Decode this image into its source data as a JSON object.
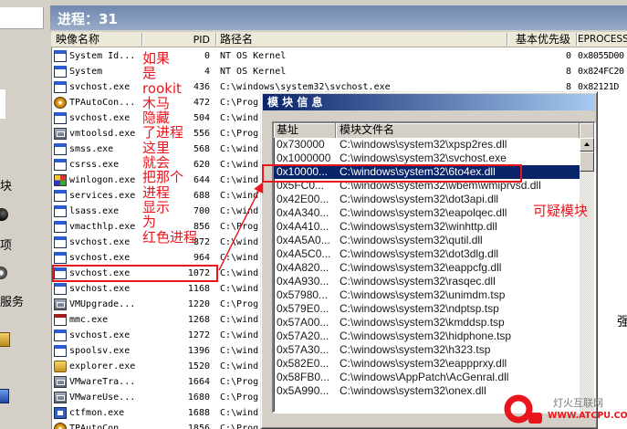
{
  "window": {
    "title": "进程：31"
  },
  "sidebar": {
    "labels": [
      "块",
      "项",
      "服务"
    ]
  },
  "process_list": {
    "columns": {
      "name": "映像名称",
      "pid": "PID",
      "path": "路径名",
      "priority": "基本优先级",
      "eprocess": "EPROCESS"
    },
    "rows": [
      {
        "icon": "app-window-icon",
        "name": "System Id...",
        "pid": "0",
        "path": "NT OS Kernel",
        "priority": "0",
        "eprocess": "0x8055D00"
      },
      {
        "icon": "app-window-icon",
        "name": "System",
        "pid": "4",
        "path": "NT OS Kernel",
        "priority": "8",
        "eprocess": "0x824FC20"
      },
      {
        "icon": "app-window-icon",
        "name": "svchost.exe",
        "pid": "436",
        "path": "C:\\windows\\system32\\svchost.exe",
        "priority": "8",
        "eprocess": "0x82121D"
      },
      {
        "icon": "gear-icon",
        "name": "TPAutoCon...",
        "pid": "472",
        "path": "C:\\Prog"
      },
      {
        "icon": "app-window-icon",
        "name": "svchost.exe",
        "pid": "504",
        "path": "C:\\wind"
      },
      {
        "icon": "vmware-icon",
        "name": "vmtoolsd.exe",
        "pid": "556",
        "path": "C:\\Prog"
      },
      {
        "icon": "app-window-icon",
        "name": "smss.exe",
        "pid": "568",
        "path": "C:\\wind"
      },
      {
        "icon": "app-window-icon",
        "name": "csrss.exe",
        "pid": "620",
        "path": "C:\\wind"
      },
      {
        "icon": "winlogon-icon",
        "name": "winlogon.exe",
        "pid": "644",
        "path": "C:\\wind"
      },
      {
        "icon": "app-window-icon",
        "name": "services.exe",
        "pid": "688",
        "path": "C:\\wind"
      },
      {
        "icon": "app-window-icon",
        "name": "lsass.exe",
        "pid": "700",
        "path": "C:\\wind"
      },
      {
        "icon": "app-window-icon",
        "name": "vmacthlp.exe",
        "pid": "856",
        "path": "C:\\Prog"
      },
      {
        "icon": "app-window-icon",
        "name": "svchost.exe",
        "pid": "872",
        "path": "C:\\wind"
      },
      {
        "icon": "app-window-icon",
        "name": "svchost.exe",
        "pid": "964",
        "path": "C:\\wind"
      },
      {
        "icon": "app-window-icon",
        "name": "svchost.exe",
        "pid": "1072",
        "path": "C:\\wind"
      },
      {
        "icon": "app-window-icon",
        "name": "svchost.exe",
        "pid": "1168",
        "path": "C:\\wind"
      },
      {
        "icon": "vmware-icon",
        "name": "VMUpgrade...",
        "pid": "1220",
        "path": "C:\\Prog"
      },
      {
        "icon": "mmc-icon",
        "name": "mmc.exe",
        "pid": "1268",
        "path": "C:\\wind"
      },
      {
        "icon": "app-window-icon",
        "name": "svchost.exe",
        "pid": "1272",
        "path": "C:\\wind"
      },
      {
        "icon": "app-window-icon",
        "name": "spoolsv.exe",
        "pid": "1396",
        "path": "C:\\wind"
      },
      {
        "icon": "explorer-icon",
        "name": "explorer.exe",
        "pid": "1520",
        "path": "C:\\wind"
      },
      {
        "icon": "vmware-icon",
        "name": "VMwareTra...",
        "pid": "1664",
        "path": "C:\\Prog"
      },
      {
        "icon": "vmware-icon",
        "name": "VMwareUse...",
        "pid": "1680",
        "path": "C:\\Prog"
      },
      {
        "icon": "ctfmon-icon",
        "name": "ctfmon.exe",
        "pid": "1688",
        "path": "C:\\wind"
      },
      {
        "icon": "gear-icon",
        "name": "TPAutoCon...",
        "pid": "1856",
        "path": "C:\\Prog"
      }
    ]
  },
  "module_dialog": {
    "title": "模 块 信 息",
    "columns": {
      "base": "基址",
      "file": "模块文件名"
    },
    "selected_index": 2,
    "rows": [
      {
        "base": "0x730000",
        "file": "C:\\windows\\system32\\xpsp2res.dll"
      },
      {
        "base": "0x1000000",
        "file": "C:\\windows\\system32\\svchost.exe"
      },
      {
        "base": "0x10000...",
        "file": "C:\\windows\\system32\\6to4ex.dll"
      },
      {
        "base": "0x5FC0...",
        "file": "C:\\windows\\system32\\wbem\\wmiprvsd.dll"
      },
      {
        "base": "0x42E00...",
        "file": "C:\\windows\\system32\\dot3api.dll"
      },
      {
        "base": "0x4A340...",
        "file": "C:\\windows\\system32\\eapolqec.dll"
      },
      {
        "base": "0x4A410...",
        "file": "C:\\windows\\system32\\winhttp.dll"
      },
      {
        "base": "0x4A5A0...",
        "file": "C:\\windows\\system32\\qutil.dll"
      },
      {
        "base": "0x4A5C0...",
        "file": "C:\\windows\\system32\\dot3dlg.dll"
      },
      {
        "base": "0x4A820...",
        "file": "C:\\windows\\system32\\eappcfg.dll"
      },
      {
        "base": "0x4A930...",
        "file": "C:\\windows\\system32\\rasqec.dll"
      },
      {
        "base": "0x57980...",
        "file": "C:\\windows\\system32\\unimdm.tsp"
      },
      {
        "base": "0x579E0...",
        "file": "C:\\windows\\system32\\ndptsp.tsp"
      },
      {
        "base": "0x57A00...",
        "file": "C:\\windows\\system32\\kmddsp.tsp"
      },
      {
        "base": "0x57A20...",
        "file": "C:\\windows\\system32\\hidphone.tsp"
      },
      {
        "base": "0x57A30...",
        "file": "C:\\windows\\system32\\h323.tsp"
      },
      {
        "base": "0x582E0...",
        "file": "C:\\windows\\system32\\eappprxy.dll"
      },
      {
        "base": "0x58FB0...",
        "file": "C:\\windows\\AppPatch\\AcGenral.dll"
      },
      {
        "base": "0x5A990...",
        "file": "C:\\windows\\system32\\onex.dll"
      }
    ]
  },
  "annotations": {
    "note_lines": [
      "如果",
      "是",
      "rookit",
      "木马",
      "隐藏",
      "了进程",
      "这里",
      "就会",
      "把那个",
      "进程",
      "显示",
      "为",
      "红色进程"
    ],
    "flagged_process_index": 14,
    "suspicious_label": "可疑模块"
  },
  "right_fragment": "强",
  "watermark": {
    "site_name": "灯火互联网",
    "url": "WWW.ATCPU.COM"
  },
  "colors": {
    "annotation_red": "#e8161c",
    "selection": "#0a246a"
  }
}
